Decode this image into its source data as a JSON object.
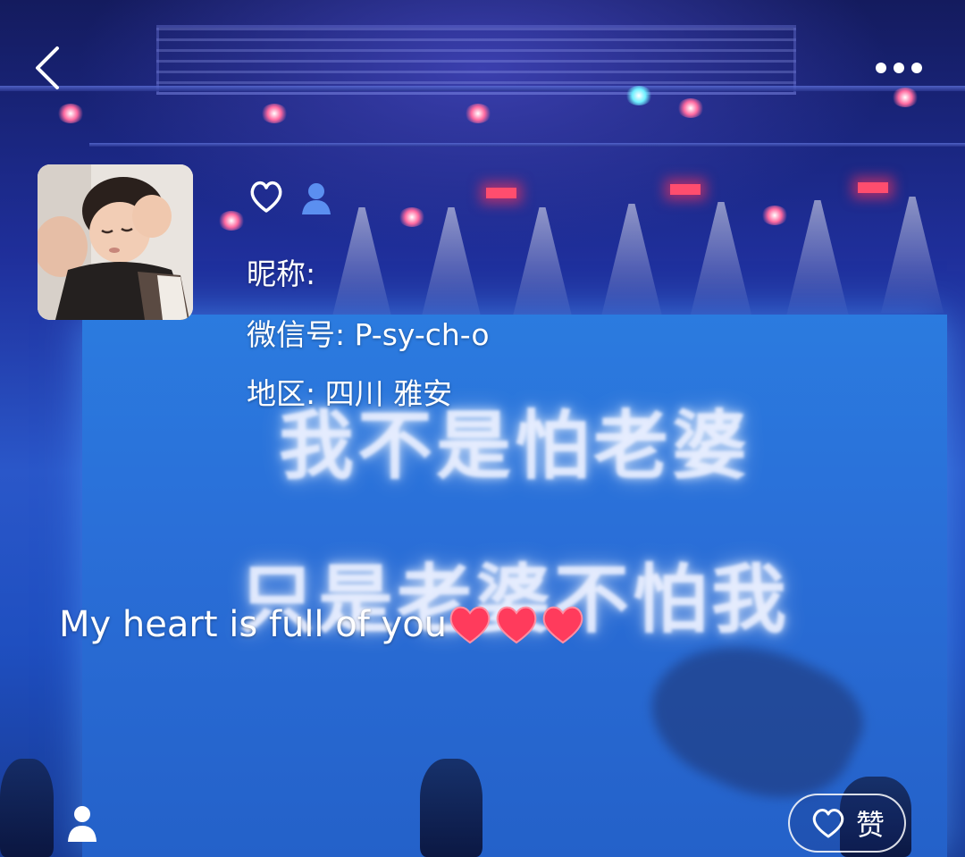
{
  "nav": {
    "back_icon": "chevron-left-icon",
    "more_icon": "more-dots-icon"
  },
  "profile": {
    "avatar": "child-photo-avatar",
    "favorite_icon": "heart-outline-icon",
    "person_icon": "person-icon",
    "nickname_label": "昵称:",
    "wechat_id_line": "微信号: P-sy-ch-o",
    "region_line": "地区: 四川  雅安"
  },
  "background": {
    "screen_line_1": "我不是怕老婆",
    "screen_line_2": "只是老婆不怕我"
  },
  "post": {
    "caption_text": "My heart is full of you",
    "caption_emoji": "red-heart-icon",
    "caption_emoji_count": 3
  },
  "footer": {
    "user_icon": "person-icon",
    "like_label": "赞",
    "like_icon": "heart-outline-icon"
  },
  "colors": {
    "text": "#ffffff",
    "heart_emoji": "#ff3b5c",
    "stage_blue": "#2a6fd8",
    "person_icon_blue": "#5b8ff0"
  }
}
